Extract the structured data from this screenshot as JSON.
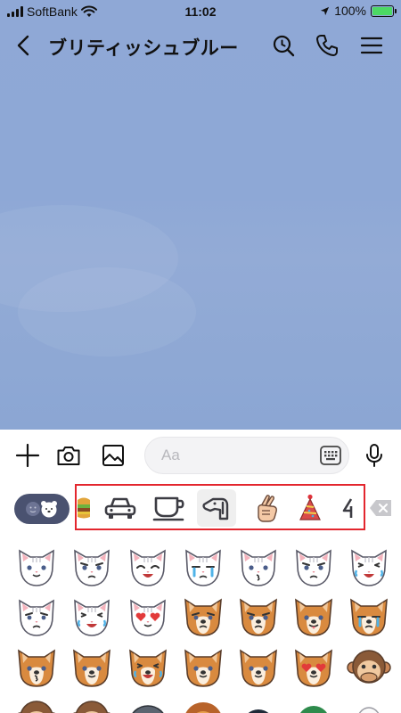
{
  "status_bar": {
    "carrier": "SoftBank",
    "time": "11:02",
    "battery_percent": "100%",
    "battery_level": 1.0
  },
  "header": {
    "title": "ブリティッシュブルー",
    "icons": [
      "back-arrow-icon",
      "search-icon",
      "phone-icon",
      "menu-icon"
    ]
  },
  "input_bar": {
    "placeholder": "Aa",
    "value": "",
    "icons": [
      "plus-icon",
      "camera-icon",
      "image-icon",
      "keyboard-icon",
      "microphone-icon"
    ]
  },
  "emoji_tabs": {
    "selected_index": 3,
    "items": [
      "burger-icon",
      "car-icon",
      "coffee-cup-icon",
      "dog-outline-icon",
      "crossed-fingers-icon",
      "party-hat-icon",
      "partial-tab-icon"
    ],
    "colors": {
      "highlight": "#e3262e",
      "pill": "#4a5270",
      "active_bg": "#efefef"
    }
  },
  "stickers": {
    "rows": [
      [
        "white-cat-smile",
        "white-cat-angry",
        "white-cat-happy-closed-eyes",
        "white-cat-crying",
        "white-cat-kiss",
        "white-cat-angry-2",
        "white-cat-laughing"
      ],
      [
        "white-cat-sad",
        "white-cat-laughing-tears",
        "white-cat-heart-eyes",
        "shiba-dog-sad",
        "shiba-dog-angry",
        "shiba-dog-tongue",
        "shiba-dog-crying"
      ],
      [
        "shiba-dog-kiss",
        "shiba-dog-smile",
        "shiba-dog-laugh",
        "shiba-dog-neutral",
        "shiba-dog-sweat",
        "shiba-dog-heart-eyes",
        "monkey-speak-no-evil"
      ],
      [
        "monkey-see-no-evil",
        "monkey-hear-no-evil",
        "dog-gray",
        "lion",
        "penguin",
        "duck",
        "goose"
      ]
    ]
  }
}
